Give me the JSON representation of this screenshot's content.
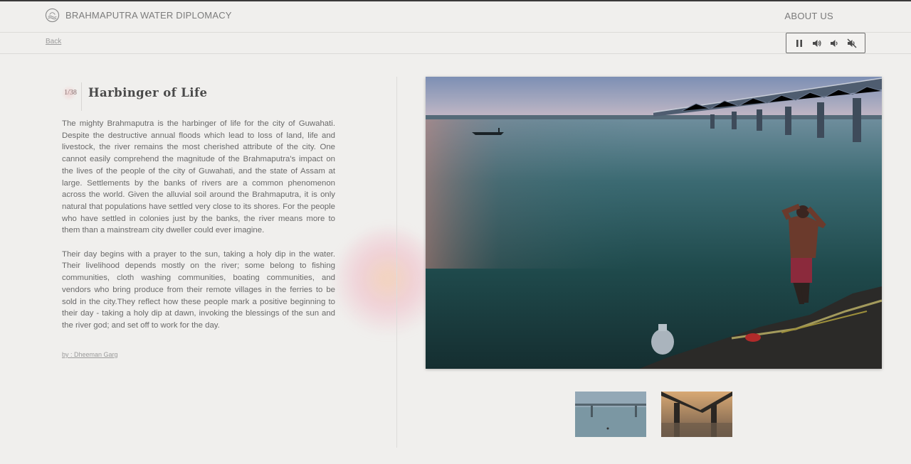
{
  "header": {
    "brand": "BRAHMAPUTRA WATER DIPLOMACY",
    "about": "ABOUT US"
  },
  "nav": {
    "back": "Back"
  },
  "audio": {
    "controls": [
      "pause-icon",
      "volume-up-icon",
      "volume-down-icon",
      "mute-icon"
    ]
  },
  "story": {
    "counter": "1/38",
    "title": "Harbinger of Life",
    "paragraphs": [
      "The mighty Brahmaputra is the harbinger of life for the city of Guwahati. Despite the destructive annual floods which lead to loss of land, life and livestock, the river remains the most cherished attribute of the city. One cannot easily comprehend the magnitude of the Brahmaputra's impact on the lives of the people of the city of Guwahati, and the state of Assam at large. Settlements by the banks of rivers are a common phenomenon across the world. Given the alluvial soil around the Brahmaputra, it is only natural that populations have settled very close to its shores. For the people who have settled in colonies just by the banks, the river means more to them than a mainstream city dweller could ever imagine.",
      "Their day begins with a prayer to the sun, taking a holy dip in the water. Their livelihood depends mostly on the river; some belong to fishing communities, cloth washing communities, boating communities, and vendors who bring produce from their remote villages in the ferries to be sold in the city.They reflect how these people mark a positive beginning to their day - taking a holy dip at dawn, invoking the blessings of the sun and the river god; and set off to work for the day."
    ],
    "credit": "by : Dheeman Garg"
  },
  "colors": {
    "background": "#f0efed",
    "water": "#1f4a4c",
    "sky": "#8a9ab8"
  }
}
